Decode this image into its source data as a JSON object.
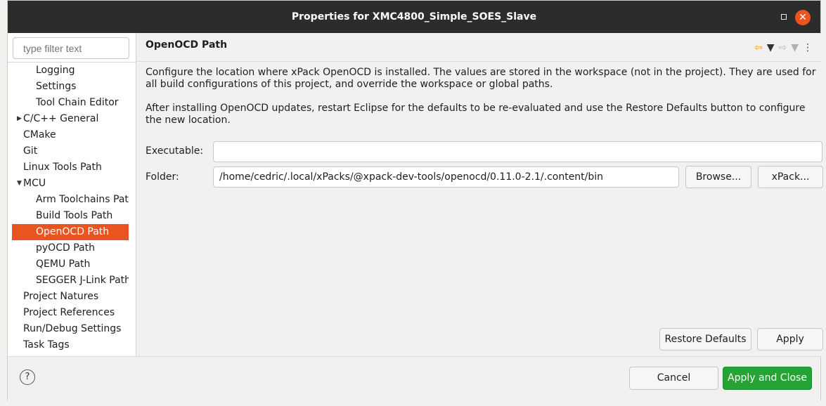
{
  "window": {
    "title": "Properties for XMC4800_Simple_SOES_Slave",
    "close_glyph": "✕"
  },
  "sidebar": {
    "filter_placeholder": "type filter text",
    "items": [
      {
        "label": "Logging",
        "indent": 2,
        "expander": ""
      },
      {
        "label": "Settings",
        "indent": 2,
        "expander": ""
      },
      {
        "label": "Tool Chain Editor",
        "indent": 2,
        "expander": ""
      },
      {
        "label": "C/C++ General",
        "indent": 1,
        "expander": "▶"
      },
      {
        "label": "CMake",
        "indent": 1,
        "expander": ""
      },
      {
        "label": "Git",
        "indent": 1,
        "expander": ""
      },
      {
        "label": "Linux Tools Path",
        "indent": 1,
        "expander": ""
      },
      {
        "label": "MCU",
        "indent": 1,
        "expander": "▼"
      },
      {
        "label": "Arm Toolchains Pat",
        "indent": 2,
        "expander": ""
      },
      {
        "label": "Build Tools Path",
        "indent": 2,
        "expander": ""
      },
      {
        "label": "OpenOCD Path",
        "indent": 2,
        "expander": "",
        "selected": true
      },
      {
        "label": "pyOCD Path",
        "indent": 2,
        "expander": ""
      },
      {
        "label": "QEMU Path",
        "indent": 2,
        "expander": ""
      },
      {
        "label": "SEGGER J-Link Path",
        "indent": 2,
        "expander": ""
      },
      {
        "label": "Project Natures",
        "indent": 1,
        "expander": ""
      },
      {
        "label": "Project References",
        "indent": 1,
        "expander": ""
      },
      {
        "label": "Run/Debug Settings",
        "indent": 1,
        "expander": ""
      },
      {
        "label": "Task Tags",
        "indent": 1,
        "expander": ""
      }
    ]
  },
  "page": {
    "title": "OpenOCD Path",
    "description_1": "Configure the location where xPack OpenOCD is installed. The values are stored in the workspace (not in the project). They are used for all build configurations of this project, and override the workspace or global paths.",
    "description_2": "After installing OpenOCD updates, restart Eclipse for the defaults to be re-evaluated and use the Restore Defaults button to configure the new location.",
    "executable_label": "Executable:",
    "executable_value": "",
    "folder_label": "Folder:",
    "folder_value": "/home/cedric/.local/xPacks/@xpack-dev-tools/openocd/0.11.0-2.1/.content/bin",
    "browse_label": "Browse...",
    "xpack_label": "xPack...",
    "restore_defaults_label": "Restore Defaults",
    "apply_label": "Apply"
  },
  "footer": {
    "help_glyph": "?",
    "cancel_label": "Cancel",
    "apply_close_label": "Apply and Close"
  },
  "icons": {
    "back": "⇦",
    "forward": "⇨",
    "dropdown": "▼",
    "menu": "⋮"
  },
  "colors": {
    "accent": "#e95420",
    "primary_button": "#26a334",
    "titlebar": "#2c2c2c"
  }
}
